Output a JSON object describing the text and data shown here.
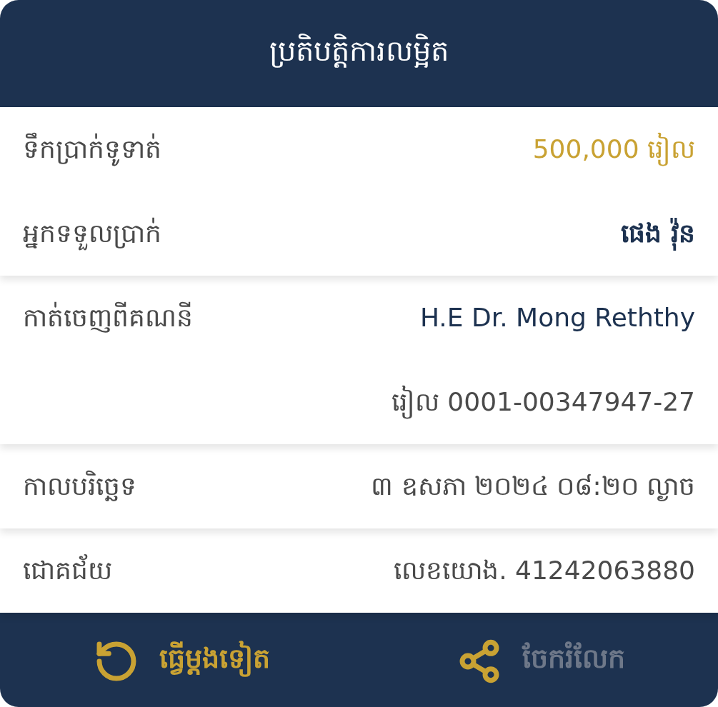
{
  "header": {
    "title": "ប្រតិបត្តិការលម្អិត"
  },
  "sections": [
    {
      "rows": [
        {
          "label": "ទឹកប្រាក់ទូទាត់",
          "values": [
            {
              "text": "500,000 រៀល",
              "kind": "amount"
            }
          ]
        },
        {
          "label": "អ្នកទទួលប្រាក់",
          "values": [
            {
              "text": "ផេង វ៉ុន",
              "kind": "name"
            }
          ]
        }
      ]
    },
    {
      "rows": [
        {
          "label": "កាត់ចេញពីគណនី",
          "values": [
            {
              "text": "H.E Dr. Mong Reththy",
              "kind": "account-name"
            },
            {
              "text": "រៀល 0001-00347947-27",
              "kind": "plain"
            }
          ]
        }
      ]
    },
    {
      "rows": [
        {
          "label": "កាលបរិច្ឆេទ",
          "values": [
            {
              "text": "៣ ឧសភា ២០២៤ ០៨:២០ ល្ងាច",
              "kind": "plain"
            }
          ]
        }
      ]
    },
    {
      "rows": [
        {
          "label": "ជោគជ័យ",
          "values": [
            {
              "text": "លេខយោង. 41242063880",
              "kind": "plain"
            }
          ]
        }
      ]
    }
  ],
  "footer": {
    "actions": [
      {
        "label": "ធ្វើម្តងទៀត",
        "kind": "retry",
        "disabled": false
      },
      {
        "label": "ចែករំលែក",
        "kind": "share",
        "disabled": true
      }
    ]
  }
}
